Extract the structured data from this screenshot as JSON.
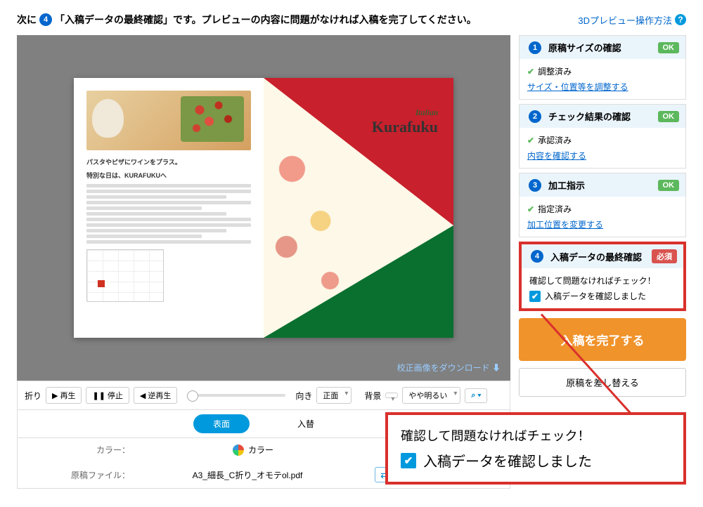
{
  "header": {
    "prefix": "次に",
    "step_num": "4",
    "text": "「入稿データの最終確認」です。プレビューの内容に問題がなければ入稿を完了してください。",
    "help": "3Dプレビュー操作方法"
  },
  "preview": {
    "doc_title1": "パスタやピザにワインをプラス。",
    "doc_title2": "特別な日は、KURAFUKUへ",
    "logo_italic": "Italian",
    "logo_main": "Kurafuku",
    "download": "校正画像をダウンロード ⬇"
  },
  "toolbar": {
    "fold": "折り",
    "play": "再生",
    "stop": "停止",
    "reverse": "逆再生",
    "orient": "向き",
    "orient_val": "正面",
    "bg": "背景",
    "bg_val": "やや明るい"
  },
  "tabs": {
    "front": "表面",
    "swap": "入替"
  },
  "meta": {
    "color_label": "カラー：",
    "color_val": "カラー",
    "file_label": "原稿ファイル：",
    "file_val": "A3_細長_C折り_オモテol.pdf",
    "file_val2": "A3_細"
  },
  "steps": {
    "s1": {
      "num": "1",
      "title": "原稿サイズの確認",
      "badge": "OK",
      "status": "調整済み",
      "link": "サイズ・位置等を調整する"
    },
    "s2": {
      "num": "2",
      "title": "チェック結果の確認",
      "badge": "OK",
      "status": "承認済み",
      "link": "内容を確認する"
    },
    "s3": {
      "num": "3",
      "title": "加工指示",
      "badge": "OK",
      "status": "指定済み",
      "link": "加工位置を変更する"
    },
    "s4": {
      "num": "4",
      "title": "入稿データの最終確認",
      "badge": "必須",
      "confirm": "確認して問題なければチェック！",
      "checkbox": "入稿データを確認しました"
    }
  },
  "buttons": {
    "complete": "入稿を完了する",
    "replace": "原稿を差し替える"
  },
  "callout": {
    "line1": "確認して問題なければチェック！",
    "line2": "入稿データを確認しました"
  }
}
